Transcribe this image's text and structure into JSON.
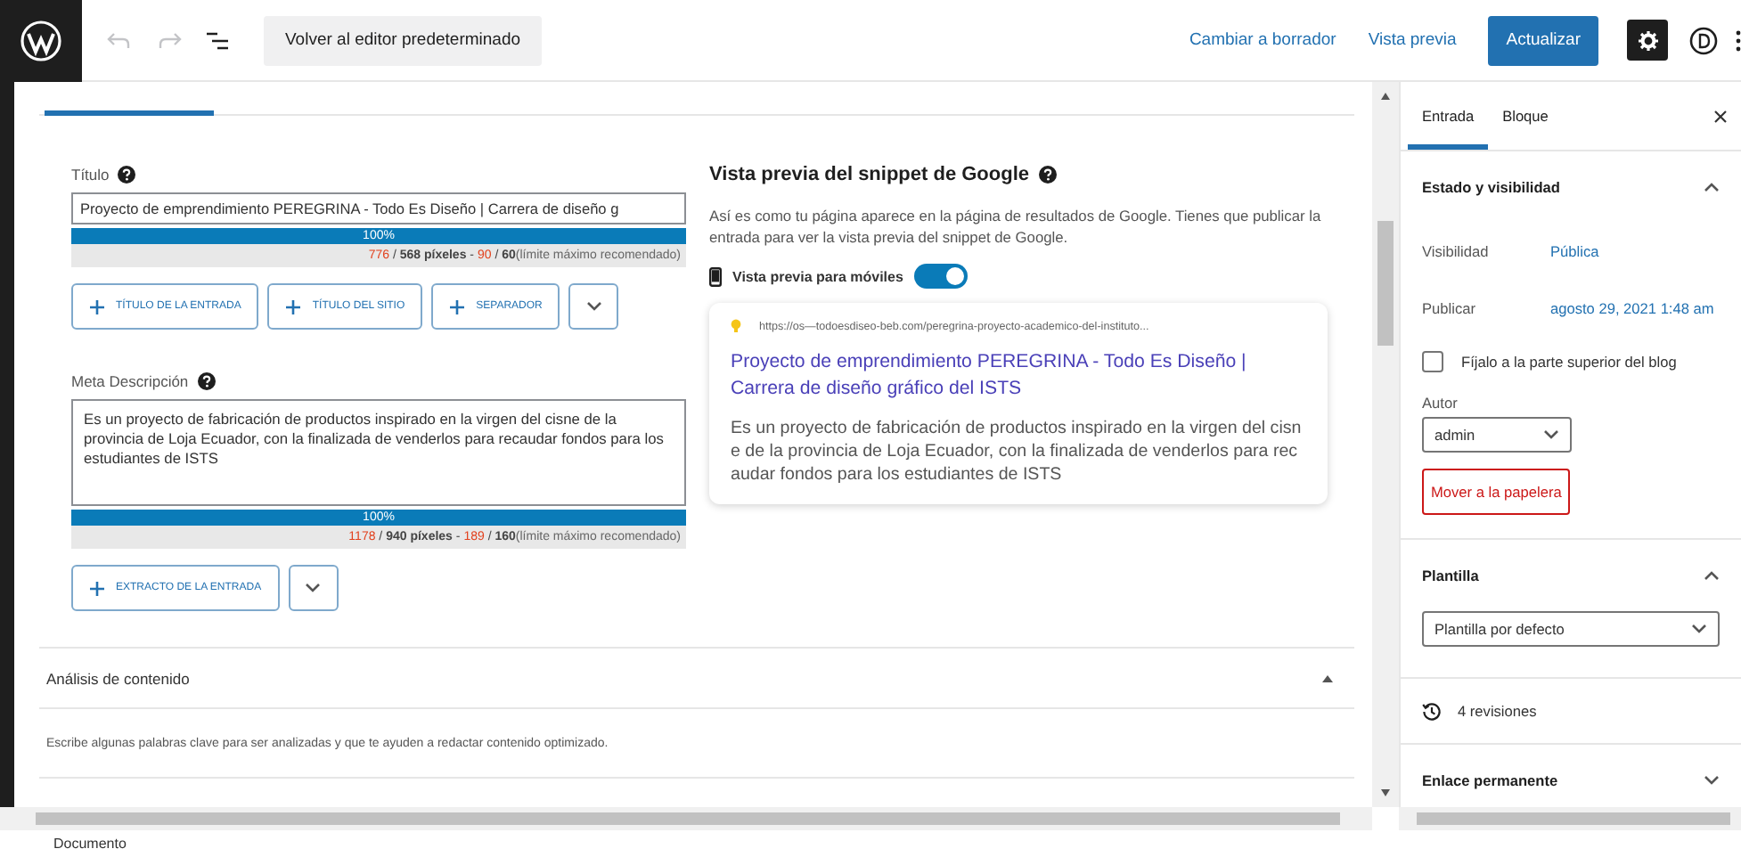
{
  "toolbar": {
    "undo_disabled": true,
    "redo_disabled": true,
    "back_button": "Volver al editor predeterminado",
    "links": [
      "Cambiar a borrador",
      "Vista previa"
    ],
    "update_button": "Actualizar",
    "settings_selected": true
  },
  "seo": {
    "fields": [
      {
        "kind": "input",
        "label": "Título",
        "value": "Proyecto de emprendimiento PEREGRINA - Todo Es Diseño | Carrera de diseño g",
        "progress": {
          "level": 1,
          "label": "100%"
        },
        "counter": [
          {
            "kind": "over",
            "text": "776"
          },
          {
            "kind": "plain",
            "text": " / "
          },
          {
            "kind": "bold",
            "text": "568 píxeles"
          },
          {
            "kind": "plain",
            "text": " - "
          },
          {
            "kind": "over",
            "text": "90"
          },
          {
            "kind": "plain",
            "text": " / "
          },
          {
            "kind": "bold",
            "text": "60"
          },
          {
            "kind": "note",
            "text": "(límite máximo recomendado)"
          }
        ],
        "variables": [
          "TÍTULO DE LA ENTRADA",
          "TÍTULO DEL SITIO",
          "SEPARADOR"
        ]
      },
      {
        "kind": "textarea",
        "label": "Meta Descripción",
        "value": "Es un proyecto de fabricación de productos inspirado en la virgen del cisne de la provincia de Loja Ecuador, con la finalizada de venderlos para recaudar fondos para los estudiantes de ISTS",
        "progress": {
          "level": 1,
          "label": "100%"
        },
        "counter": [
          {
            "kind": "over",
            "text": "1178"
          },
          {
            "kind": "plain",
            "text": " / "
          },
          {
            "kind": "bold",
            "text": "940 píxeles"
          },
          {
            "kind": "plain",
            "text": " - "
          },
          {
            "kind": "over",
            "text": "189"
          },
          {
            "kind": "plain",
            "text": " / "
          },
          {
            "kind": "bold",
            "text": "160"
          },
          {
            "kind": "note",
            "text": "(límite máximo recomendado)"
          }
        ],
        "variables": [
          "EXTRACTO DE LA ENTRADA"
        ]
      }
    ],
    "preview": {
      "heading": "Vista previa del snippet de Google",
      "intro": "Así es como tu página aparece en la página de resultados de Google. Tienes que publicar la entrada para ver la vista previa del snippet de Google.",
      "mobile": {
        "label": "Vista previa para móviles",
        "on": true
      },
      "card": {
        "url": "https://os—todoesdiseo-beb.com/peregrina-proyecto-academico-del-instituto...",
        "title": "Proyecto de emprendimiento PEREGRINA - Todo Es Diseño | Carrera de diseño gráfico del ISTS",
        "description": "Es un proyecto de fabricación de productos inspirado en la virgen del cisne de la provincia de Loja Ecuador, con la finalizada de venderlos para recaudar fondos para los estudiantes de ISTS"
      }
    }
  },
  "analysis": {
    "heading": "Análisis de contenido",
    "expanded": true,
    "text": "Escribe algunas palabras clave para ser analizadas y que te ayuden a redactar contenido optimizado."
  },
  "sidebar": {
    "tabs": [
      {
        "label": "Entrada",
        "selected": true
      },
      {
        "label": "Bloque",
        "selected": false
      }
    ],
    "panels": [
      {
        "kind": "status",
        "title": "Estado y visibilidad",
        "expanded": true,
        "rows": [
          {
            "label": "Visibilidad",
            "value": "Pública"
          },
          {
            "label": "Publicar",
            "value": "agosto 29, 2021 1:48 am"
          }
        ],
        "sticky": {
          "label": "Fíjalo a la parte superior del blog",
          "checked": false
        },
        "author": {
          "label": "Autor",
          "value": "admin"
        },
        "trash_button": "Mover a la papelera"
      },
      {
        "kind": "template",
        "title": "Plantilla",
        "expanded": true,
        "value": "Plantilla por defecto"
      },
      {
        "kind": "revisions",
        "label": "4 revisiones"
      },
      {
        "kind": "permalink",
        "title": "Enlace permanente",
        "expanded": false
      }
    ]
  },
  "status_bar": "Documento"
}
